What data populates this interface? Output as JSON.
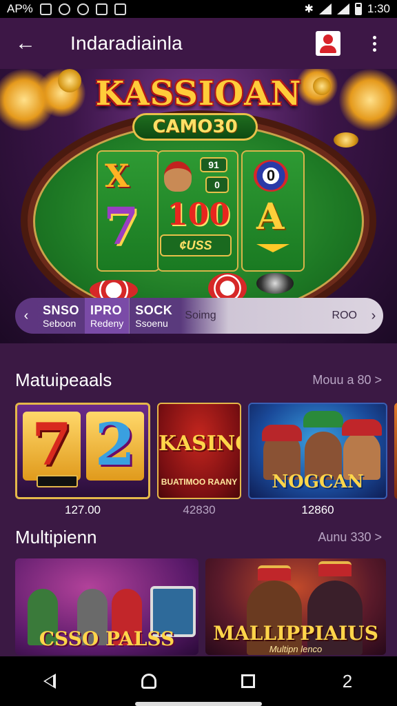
{
  "status_bar": {
    "carrier": "AP%",
    "time": "1:30"
  },
  "app_bar": {
    "title": "Indaradiainla"
  },
  "hero": {
    "brand": "KASSIOAN",
    "subbrand": "CAMO30",
    "reel_x": "X",
    "reel_seven": "7",
    "reel_hundred": "100",
    "reel_a": "A",
    "reel_o": "0",
    "badge_top": "91",
    "badge_bottom": "0",
    "bet_label": "¢USS"
  },
  "category_strip": {
    "segments": [
      {
        "title": "SNSO",
        "subtitle": "Seboon"
      },
      {
        "title": "IPRO",
        "subtitle": "Redeny"
      },
      {
        "title": "SOCK",
        "subtitle": "Ssoenu"
      }
    ],
    "search_text": "Soimg",
    "count_text": "ROO"
  },
  "sections": [
    {
      "title": "Matuipeaals",
      "more": "Mouu a 80 >",
      "cards": [
        {
          "caption": "127.00"
        },
        {
          "title": "KASINO",
          "subtitle": "BUATIMOO RAANY",
          "caption": "42830"
        },
        {
          "title": "NOGCAN",
          "caption": "12860"
        }
      ]
    },
    {
      "title": "Multipienn",
      "more": "Aunu 330 >",
      "cards": [
        {
          "title": "CSSO PALSS"
        },
        {
          "title": "MALLIPPIAIUS",
          "subtitle": "Multipn lenco"
        }
      ]
    }
  ],
  "nav": {
    "extra": "2"
  },
  "colors": {
    "background": "#3a1942",
    "accent": "#e5b84a",
    "strip": "#5e3680"
  }
}
